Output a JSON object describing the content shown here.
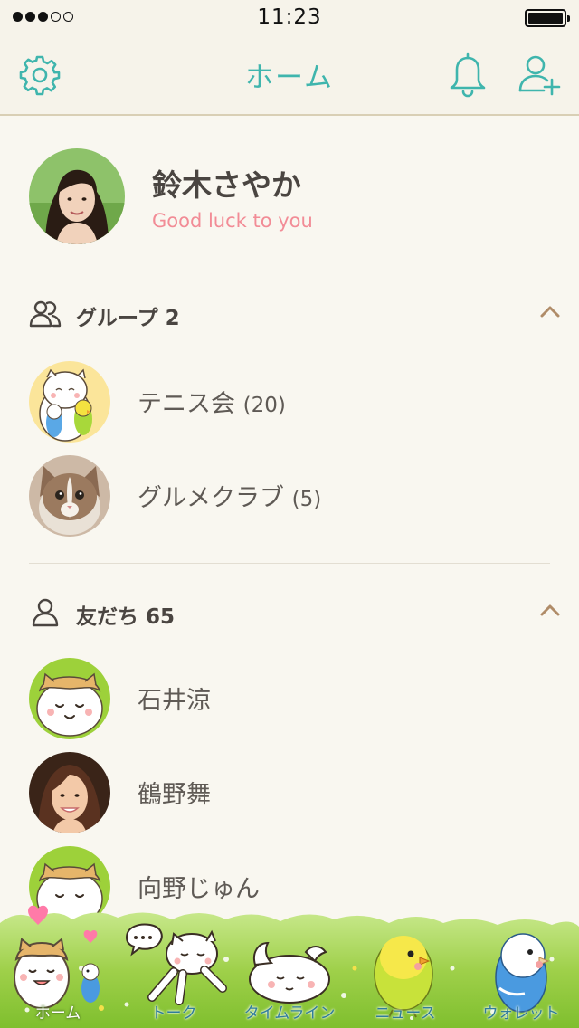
{
  "status_bar": {
    "signal_strength": 3,
    "signal_max": 5,
    "time": "11:23",
    "battery_level": 1.0
  },
  "nav": {
    "title": "ホーム",
    "icons": [
      "gear-icon",
      "bell-icon",
      "add-friend-icon"
    ]
  },
  "profile": {
    "name": "鈴木さやか",
    "status_message": "Good luck to you"
  },
  "groups": {
    "title": "グループ 2",
    "icon": "group-icon",
    "expanded": true,
    "items": [
      {
        "name": "テニス会",
        "count": "(20)"
      },
      {
        "name": "グルメクラブ",
        "count": "(5)"
      }
    ]
  },
  "friends": {
    "title": "友だち 65",
    "icon": "person-icon",
    "expanded": true,
    "items": [
      {
        "name": "石井涼"
      },
      {
        "name": "鶴野舞"
      },
      {
        "name": "向野じゅん"
      }
    ]
  },
  "tabs": [
    {
      "label": "ホーム",
      "active": true
    },
    {
      "label": "トーク",
      "active": false
    },
    {
      "label": "タイムライン",
      "active": false
    },
    {
      "label": "ニュース",
      "active": false
    },
    {
      "label": "ウォレット",
      "active": false
    }
  ],
  "colors": {
    "accent": "#3fb5ad",
    "status_pink": "#f28c96",
    "background": "#f9f7f0",
    "chevron": "#b08c68"
  }
}
